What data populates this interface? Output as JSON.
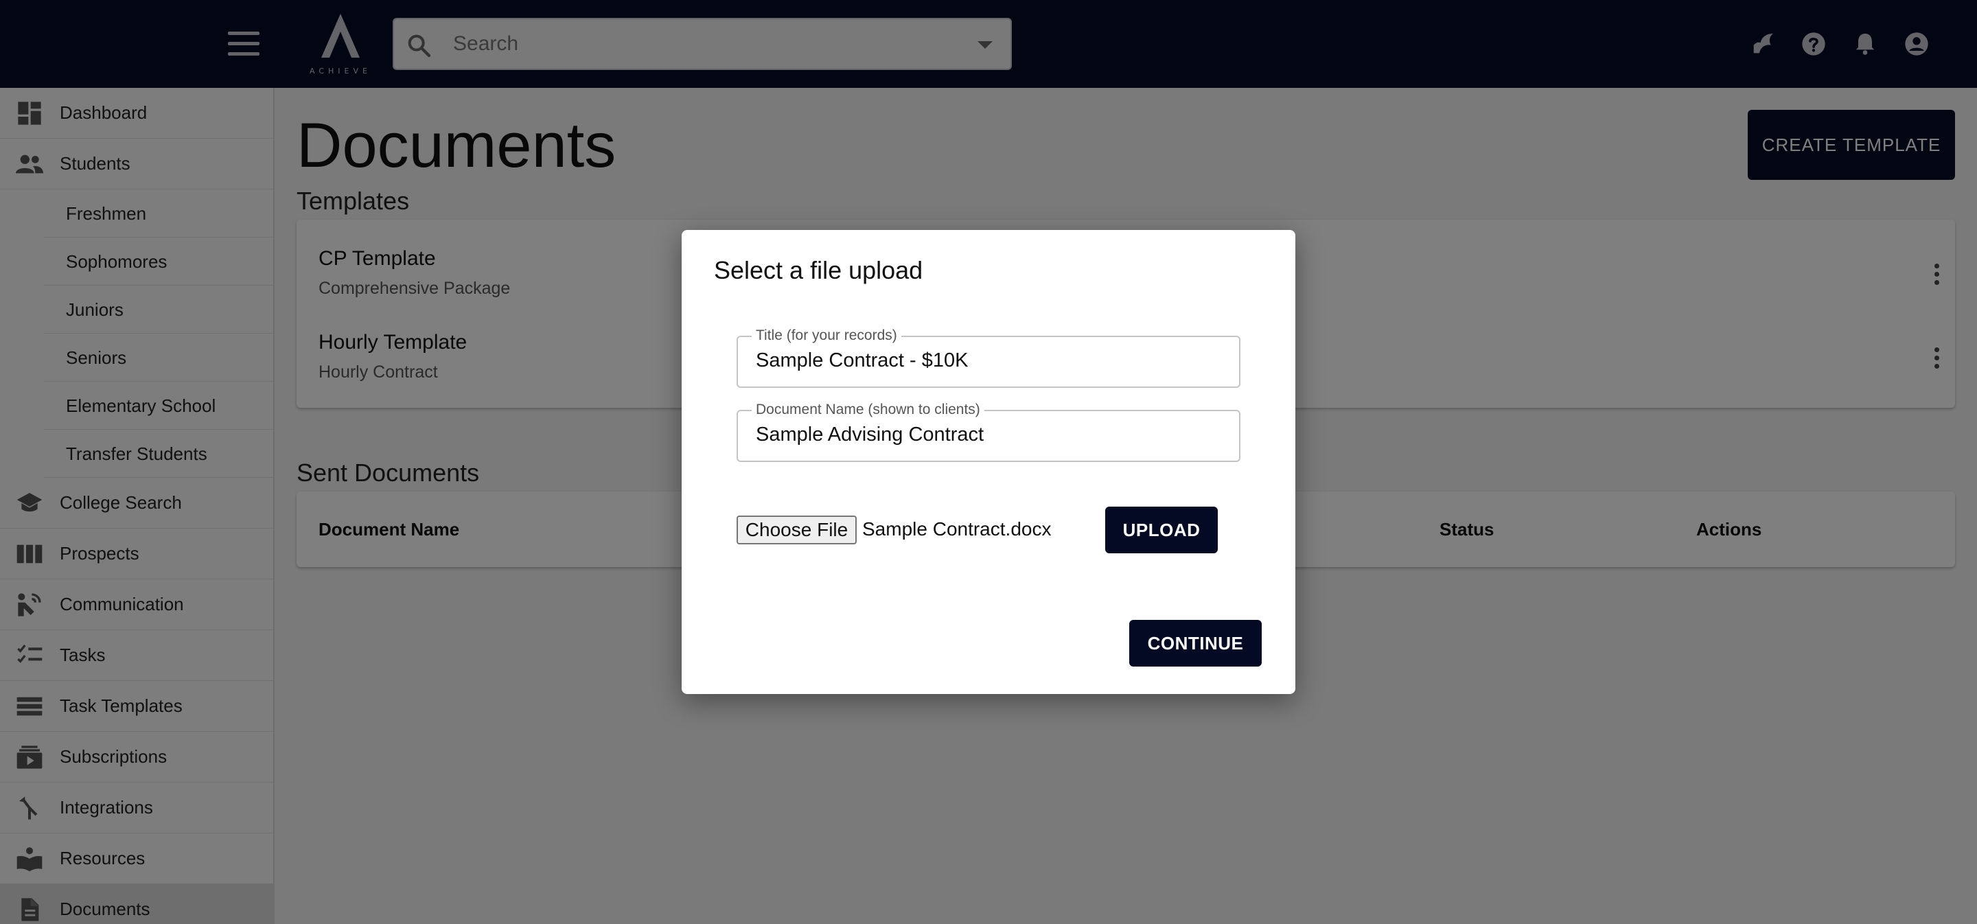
{
  "header": {
    "logo_text": "ACHIEVE",
    "search_placeholder": "Search",
    "icons": [
      "theme-toggle-icon",
      "help-icon",
      "notifications-icon",
      "account-icon"
    ]
  },
  "sidebar": {
    "items": [
      {
        "label": "Dashboard",
        "icon": "dashboard-icon"
      },
      {
        "label": "Students",
        "icon": "people-icon"
      },
      {
        "label": "Freshmen"
      },
      {
        "label": "Sophomores"
      },
      {
        "label": "Juniors"
      },
      {
        "label": "Seniors"
      },
      {
        "label": "Elementary School"
      },
      {
        "label": "Transfer Students"
      },
      {
        "label": "College Search",
        "icon": "school-icon"
      },
      {
        "label": "Prospects",
        "icon": "columns-icon"
      },
      {
        "label": "Communication",
        "icon": "communication-icon"
      },
      {
        "label": "Tasks",
        "icon": "checklist-icon"
      },
      {
        "label": "Task Templates",
        "icon": "list-icon"
      },
      {
        "label": "Subscriptions",
        "icon": "subscriptions-icon"
      },
      {
        "label": "Integrations",
        "icon": "merge-icon"
      },
      {
        "label": "Resources",
        "icon": "book-icon"
      },
      {
        "label": "Documents",
        "icon": "document-icon",
        "active": true
      }
    ]
  },
  "main": {
    "title": "Documents",
    "create_button": "CREATE TEMPLATE",
    "templates_heading": "Templates",
    "templates": [
      {
        "name": "CP Template",
        "subtitle": "Comprehensive Package"
      },
      {
        "name": "Hourly Template",
        "subtitle": "Hourly Contract"
      }
    ],
    "sent_heading": "Sent Documents",
    "sent_columns": [
      "Document Name",
      "Status",
      "Actions"
    ]
  },
  "dialog": {
    "title": "Select a file upload",
    "title_field": {
      "label": "Title (for your records)",
      "value": "Sample Contract - $10K"
    },
    "doc_name_field": {
      "label": "Document Name (shown to clients)",
      "value": "Sample Advising Contract"
    },
    "choose_file_label": "Choose File",
    "file_name": "Sample Contract.docx",
    "upload_label": "UPLOAD",
    "continue_label": "CONTINUE"
  }
}
